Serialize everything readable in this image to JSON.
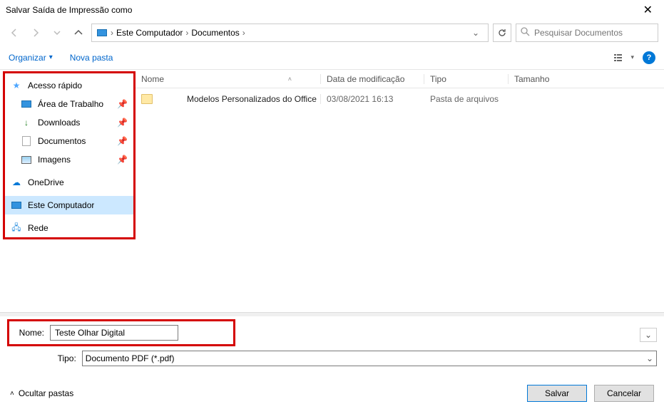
{
  "window": {
    "title": "Salvar Saída de Impressão como"
  },
  "breadcrumb": [
    "Este Computador",
    "Documentos"
  ],
  "search": {
    "placeholder": "Pesquisar Documentos"
  },
  "toolbar": {
    "organize": "Organizar",
    "newFolder": "Nova pasta"
  },
  "sidebar": {
    "quick": {
      "header": "Acesso rápido",
      "items": [
        {
          "label": "Área de Trabalho",
          "pinned": true
        },
        {
          "label": "Downloads",
          "pinned": true
        },
        {
          "label": "Documentos",
          "pinned": true
        },
        {
          "label": "Imagens",
          "pinned": true
        }
      ]
    },
    "onedrive": "OneDrive",
    "thispc": "Este Computador",
    "network": "Rede"
  },
  "columns": {
    "name": "Nome",
    "date": "Data de modificação",
    "type": "Tipo",
    "size": "Tamanho"
  },
  "rows": [
    {
      "name": "Modelos Personalizados do Office",
      "date": "03/08/2021 16:13",
      "type": "Pasta de arquivos",
      "size": ""
    }
  ],
  "form": {
    "nameLabel": "Nome:",
    "nameValue": "Teste Olhar Digital",
    "typeLabel": "Tipo:",
    "typeValue": "Documento PDF (*.pdf)"
  },
  "footer": {
    "hide": "Ocultar pastas",
    "save": "Salvar",
    "cancel": "Cancelar"
  }
}
